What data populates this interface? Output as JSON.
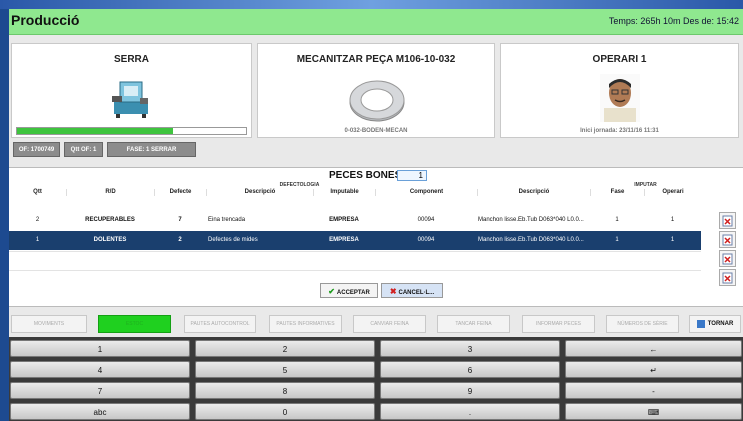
{
  "app": {
    "title": "Producció",
    "header_right": "Temps: 265h 10m   Des de: 15:42"
  },
  "cards": {
    "machine": {
      "title": "SERRA",
      "progress": 0.68,
      "image": "band-saw"
    },
    "operation": {
      "title": "MECANITZAR PEÇA M106-10-032",
      "subtitle": "0-032-BODEN-MECAN",
      "image": "metal-ring-part"
    },
    "operator": {
      "title": "OPERARI 1",
      "subtitle": "Inici jornada: 23/11/16 11:31",
      "image": "operator-photo"
    }
  },
  "tags": [
    "OF: 1700749",
    "Qtt OF: 1",
    "FASE: 1 SERRAR"
  ],
  "peces_bones": {
    "label": "PECES BONES:",
    "value": "1"
  },
  "table": {
    "group_headers": {
      "defectologia": "DEFECTOLOGIA",
      "imputar": "IMPUTAR"
    },
    "columns": [
      "Qtt",
      "R/D",
      "Defecte",
      "Descripció",
      "Imputable",
      "Component",
      "Descripció",
      "Fase",
      "Operari"
    ],
    "rows": [
      {
        "qtt": "2",
        "rd": "RECUPERABLES",
        "defecte": "7",
        "desc": "Eina trencada",
        "imputable": "EMPRESA",
        "component": "00094",
        "desc2": "Manchon lisse.Eb.Tub D063*040 L0.0...",
        "fase": "1",
        "operari": "1",
        "selected": false
      },
      {
        "qtt": "1",
        "rd": "DOLENTES",
        "defecte": "2",
        "desc": "Defectes de mides",
        "imputable": "EMPRESA",
        "component": "00094",
        "desc2": "Manchon lisse.Eb.Tub D063*040 L0.0...",
        "fase": "1",
        "operari": "1",
        "selected": true
      }
    ]
  },
  "actions": {
    "accept": "ACCEPTAR",
    "cancel": "CANCEL·L..."
  },
  "nav": [
    {
      "label": "MOVIMENTS",
      "active": false
    },
    {
      "label": "ESTOC",
      "active": true
    },
    {
      "label": "PAUTES AUTOCONTROL",
      "active": false
    },
    {
      "label": "PAUTES INFORMATIVES",
      "active": false
    },
    {
      "label": "CANVIAR FEINA",
      "active": false
    },
    {
      "label": "TANCAR FEINA",
      "active": false
    },
    {
      "label": "INFORMAR PECES",
      "active": false
    },
    {
      "label": "NÚMEROS DE SÈRIE",
      "active": false
    },
    {
      "label": "TORNAR",
      "active": false
    }
  ],
  "keypad": [
    [
      "1",
      "2",
      "3",
      "←"
    ],
    [
      "4",
      "5",
      "6",
      "↵"
    ],
    [
      "7",
      "8",
      "9",
      "-"
    ],
    [
      "abc",
      "0",
      ".",
      "⌨"
    ]
  ],
  "colors": {
    "header": "#8fe88f",
    "selected_row": "#1a3f6e",
    "active_nav": "#1fd01f",
    "keypad_bg": "#3a3a3a"
  }
}
